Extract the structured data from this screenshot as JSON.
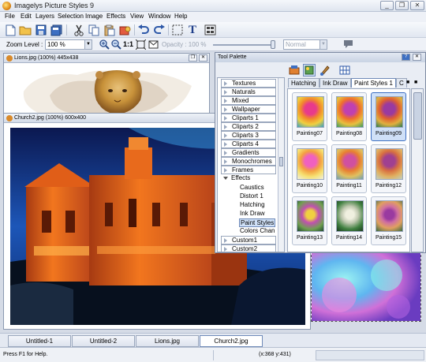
{
  "app": {
    "title": "Imagelys Picture Styles 9"
  },
  "menu": [
    "File",
    "Edit",
    "Layers",
    "Selection",
    "Image",
    "Effects",
    "View",
    "Window",
    "Help"
  ],
  "toolbar2": {
    "zoom_label": "Zoom Level :",
    "zoom_value": "100 %",
    "fit_label": "1:1",
    "opacity_label": "Opacity : 100 %",
    "blend_value": "Normal"
  },
  "docs": {
    "lions": {
      "title": "Lions.jpg (100%) 445x438"
    },
    "church": {
      "title": "Church2.jpg (100%) 600x400"
    }
  },
  "palette": {
    "title": "Tool Palette",
    "categories": [
      "Textures",
      "Naturals",
      "Mixed",
      "Wallpaper",
      "Cliparts 1",
      "Cliparts 2",
      "Cliparts 3",
      "Cliparts 4",
      "Gradients",
      "Monochromes",
      "Frames",
      "Effects"
    ],
    "effects_sub": [
      "Caustics",
      "Distort 1",
      "Hatching",
      "Ink Draw",
      "Paint Styles",
      "Colors Chan"
    ],
    "more": [
      "Custom1",
      "Custom2"
    ],
    "tabs": [
      "Hatching",
      "Ink Draw",
      "Paint Styles 1",
      "C"
    ],
    "thumbs": [
      "Painting07",
      "Painting08",
      "Painting09",
      "Painting10",
      "Painting11",
      "Painting12",
      "Painting13",
      "Painting14",
      "Painting15"
    ],
    "selected": "Painting09"
  },
  "tabs": [
    "Untitled-1",
    "Untitled-2",
    "Lions.jpg",
    "Church2.jpg"
  ],
  "status": {
    "help": "Press F1 for Help.",
    "coords": "(x:368 y:431)"
  }
}
